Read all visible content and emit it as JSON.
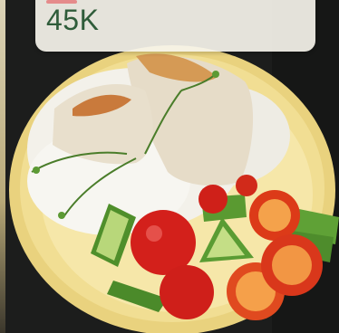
{
  "food_card": {
    "price": "45K",
    "image": {
      "icon": "food-photo",
      "colors": {
        "background": "#1a1b1a",
        "plate": "#eedc8e",
        "rice": "#f4f2ec",
        "chicken": "#e7dcc7",
        "tomato": "#d6261f",
        "cucumber": "#5f9e35"
      }
    },
    "colors": {
      "price_text": "#2f5c3a",
      "chip_bg": "#f6f4ec"
    }
  }
}
